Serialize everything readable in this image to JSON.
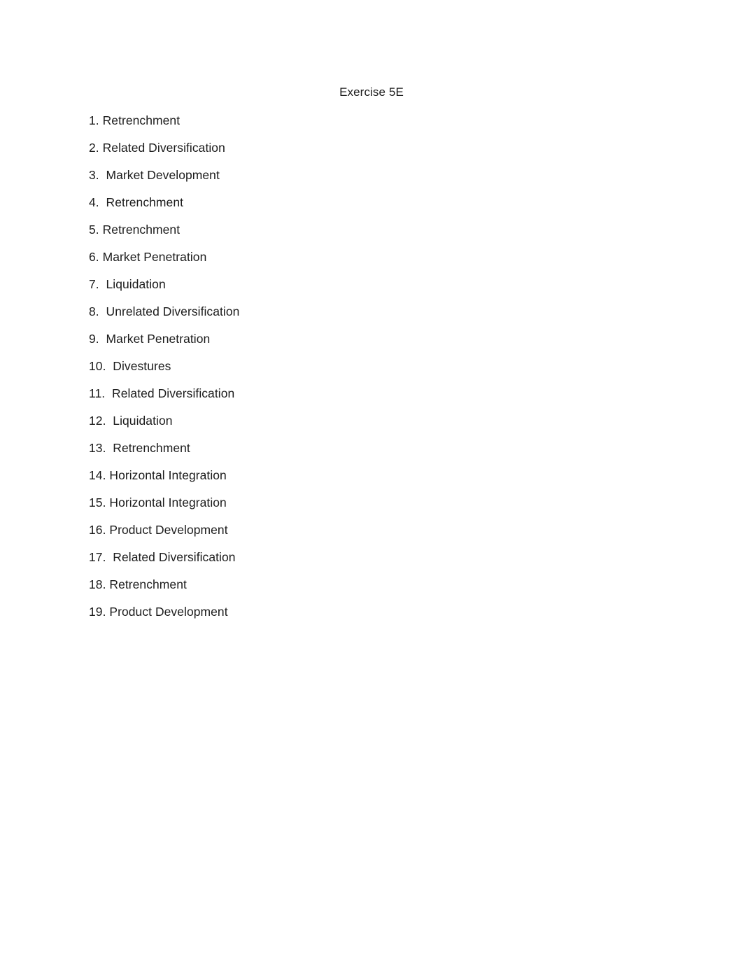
{
  "document": {
    "title": "Exercise 5E",
    "page_background": "#ffffff",
    "text_color": "#1c1c1c"
  },
  "answers": {
    "items": [
      {
        "number": "1.",
        "separator": " ",
        "strategy": "Retrenchment",
        "text": "1. Retrenchment"
      },
      {
        "number": "2.",
        "separator": " ",
        "strategy": "Related Diversification",
        "text": "2. Related Diversification"
      },
      {
        "number": "3.",
        "separator": "  ",
        "strategy": "Market Development",
        "text": "3.  Market Development"
      },
      {
        "number": "4.",
        "separator": "  ",
        "strategy": "Retrenchment",
        "text": "4.  Retrenchment"
      },
      {
        "number": "5.",
        "separator": " ",
        "strategy": "Retrenchment",
        "text": "5. Retrenchment"
      },
      {
        "number": "6.",
        "separator": " ",
        "strategy": "Market Penetration",
        "text": "6. Market Penetration"
      },
      {
        "number": "7.",
        "separator": "  ",
        "strategy": "Liquidation",
        "text": "7.  Liquidation"
      },
      {
        "number": "8.",
        "separator": "  ",
        "strategy": "Unrelated Diversification",
        "text": "8.  Unrelated Diversification"
      },
      {
        "number": "9.",
        "separator": "  ",
        "strategy": "Market Penetration",
        "text": "9.  Market Penetration"
      },
      {
        "number": "10.",
        "separator": "  ",
        "strategy": "Divestures",
        "text": "10.  Divestures"
      },
      {
        "number": "11.",
        "separator": "  ",
        "strategy": "Related Diversification",
        "text": "11.  Related Diversification"
      },
      {
        "number": "12.",
        "separator": "  ",
        "strategy": "Liquidation",
        "text": "12.  Liquidation"
      },
      {
        "number": "13.",
        "separator": "  ",
        "strategy": "Retrenchment",
        "text": "13.  Retrenchment"
      },
      {
        "number": "14.",
        "separator": " ",
        "strategy": "Horizontal Integration",
        "text": "14. Horizontal Integration"
      },
      {
        "number": "15.",
        "separator": " ",
        "strategy": "Horizontal Integration",
        "text": "15. Horizontal Integration"
      },
      {
        "number": "16.",
        "separator": " ",
        "strategy": "Product Development",
        "text": "16. Product Development"
      },
      {
        "number": "17.",
        "separator": "  ",
        "strategy": "Related Diversification",
        "text": "17.  Related Diversification"
      },
      {
        "number": "18.",
        "separator": " ",
        "strategy": "Retrenchment",
        "text": "18. Retrenchment"
      },
      {
        "number": "19.",
        "separator": " ",
        "strategy": "Product Development",
        "text": "19. Product Development"
      }
    ]
  }
}
